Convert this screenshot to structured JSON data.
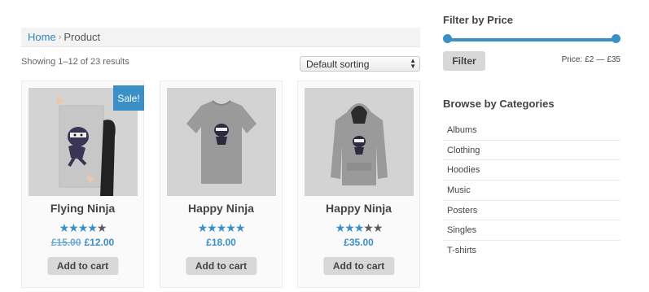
{
  "breadcrumb": {
    "home": "Home",
    "separator": "›",
    "current": "Product"
  },
  "results_text": "Showing 1–12 of 23 results",
  "sorting": {
    "selected": "Default sorting"
  },
  "products": [
    {
      "name": "Flying Ninja",
      "rating": 4,
      "max_rating": 5,
      "old_price": "£15.00",
      "price": "£12.00",
      "sale_badge": "Sale!",
      "button": "Add to cart",
      "image": "ninja-poster"
    },
    {
      "name": "Happy Ninja",
      "rating": 5,
      "max_rating": 5,
      "price": "£18.00",
      "button": "Add to cart",
      "image": "ninja-tshirt"
    },
    {
      "name": "Happy Ninja",
      "rating": 3,
      "max_rating": 5,
      "price": "£35.00",
      "button": "Add to cart",
      "image": "ninja-hoodie"
    }
  ],
  "price_filter": {
    "title": "Filter by Price",
    "button": "Filter",
    "label": "Price:",
    "min": "£2",
    "dash": "—",
    "max": "£35"
  },
  "categories": {
    "title": "Browse by Categories",
    "items": [
      "Albums",
      "Clothing",
      "Hoodies",
      "Music",
      "Posters",
      "Singles",
      "T-shirts"
    ]
  },
  "colors": {
    "accent": "#3a8fc7",
    "button_bg": "#d8d8d8",
    "image_bg": "#d3d3d3"
  }
}
